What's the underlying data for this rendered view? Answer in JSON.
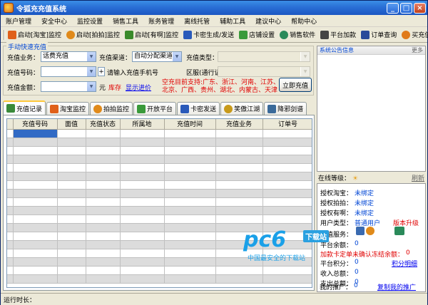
{
  "app": {
    "title": "令狐充充值系统"
  },
  "menu": [
    "账户管理",
    "安全中心",
    "监控设置",
    "销售工具",
    "账务管理",
    "离线托管",
    "辅助工具",
    "建议中心",
    "帮助中心"
  ],
  "toolbar": [
    {
      "label": "启动[淘宝]监控",
      "icon": "taobao-icon",
      "color": "#e0601a"
    },
    {
      "label": "启动[拍拍]监控",
      "icon": "paipai-icon",
      "color": "#e08a1a"
    },
    {
      "label": "启动[有啊]监控",
      "icon": "youa-icon",
      "color": "#3a8a2a"
    },
    {
      "label": "卡密生成/发送",
      "icon": "card-icon",
      "color": "#2a5aba"
    },
    {
      "label": "店铺设置",
      "icon": "shop-icon",
      "color": "#3a9a3a"
    },
    {
      "label": "销售软件",
      "icon": "software-icon",
      "color": "#2a8a5a"
    },
    {
      "label": "平台加款",
      "icon": "platform-icon",
      "color": "#444444"
    },
    {
      "label": "订单查询",
      "icon": "order-icon",
      "color": "#2a4a9a"
    },
    {
      "label": "买充值卡",
      "icon": "buy-card-icon",
      "color": "#e07a1a"
    }
  ],
  "quick": {
    "legend": "手动快速充值",
    "business_label": "充值业务：",
    "business_value": "话费充值",
    "channel_label": "充值渠道：",
    "channel_value": "自动分配渠道",
    "type_label": "充值类型：",
    "number_label": "充值号码：",
    "number_hint": "请输入充值手机号",
    "region_label": "区服(通行证)：",
    "amount_label": "充值金额：",
    "amount_unit": "元",
    "stock": "库存",
    "price_link": "显示进价",
    "support_line1": "空充目前支持:广东、浙江、河南、江苏、",
    "support_line2": "北京、广西、贵州、湖北、内蒙古、天津",
    "submit": "立即充值"
  },
  "announce": {
    "title": "系统公告信息",
    "more": "更多"
  },
  "tabs": [
    {
      "label": "充值记录",
      "icon": "record-icon",
      "color": "#3a8a3a",
      "active": true
    },
    {
      "label": "淘宝监控",
      "icon": "taobao-tab-icon",
      "color": "#e0601a",
      "active": false
    },
    {
      "label": "拍拍监控",
      "icon": "paipai-tab-icon",
      "color": "#e08a1a",
      "active": false
    },
    {
      "label": "开放平台",
      "icon": "open-platform-icon",
      "color": "#3a9a3a",
      "active": false
    },
    {
      "label": "卡密发送",
      "icon": "card-send-icon",
      "color": "#2a5aba",
      "active": false
    },
    {
      "label": "笑傲江湖",
      "icon": "game-icon",
      "color": "#c89a1a",
      "active": false
    },
    {
      "label": "降邪剑谱",
      "icon": "sword-icon",
      "color": "#3a6a9a",
      "active": false
    }
  ],
  "grid": {
    "columns": [
      "充值号码",
      "面值",
      "充值状态",
      "所属地",
      "充值时间",
      "充值业务",
      "订单号"
    ],
    "row_count": 18
  },
  "level": {
    "title": "在线等级：",
    "refresh": "刷新",
    "rows": [
      {
        "k": "授权淘宝：",
        "v": "未绑定"
      },
      {
        "k": "授权拍拍：",
        "v": "未绑定"
      },
      {
        "k": "授权有啊：",
        "v": "未绑定"
      },
      {
        "k": "用户类型：",
        "v": "普通用户",
        "extra": "版本升级"
      },
      {
        "k": "增值服务：",
        "v": ""
      },
      {
        "k": "平台余额：",
        "v": "0"
      },
      {
        "k": "加款卡定单未确认冻结余额：",
        "v": "0"
      },
      {
        "k": "平台积分：",
        "v": "0",
        "extra": "积分明细"
      },
      {
        "k": "收入总额：",
        "v": "0"
      },
      {
        "k": "支出总额：",
        "v": "0"
      },
      {
        "k": "我的推广：",
        "v": "0",
        "extra": "复制我的推广"
      }
    ]
  },
  "watermark": {
    "brand": "pc6",
    "badge": "下载站",
    "slogan": "中国最安全的下载站"
  },
  "status": {
    "runtime_label": "运行时长："
  }
}
